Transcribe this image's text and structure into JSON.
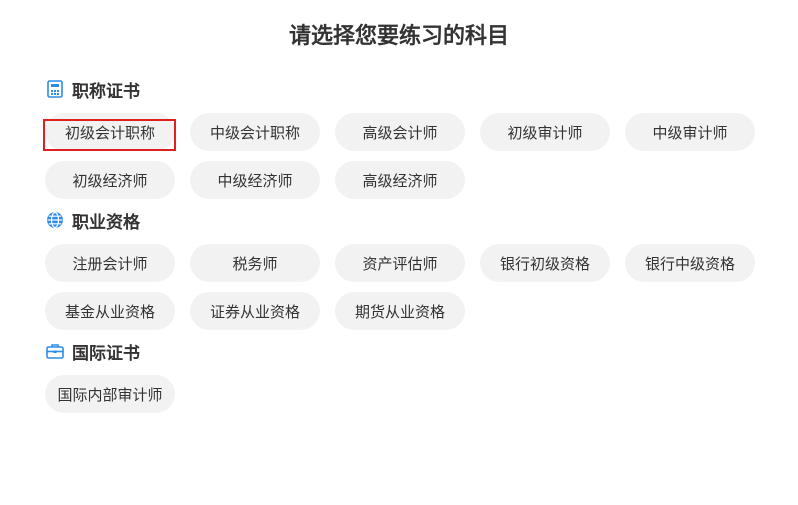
{
  "title": "请选择您要练习的科目",
  "accent_color": "#1e88e5",
  "highlight_color": "#e0201f",
  "sections": [
    {
      "label": "职称证书",
      "icon": "calculator-icon",
      "items": [
        "初级会计职称",
        "中级会计职称",
        "高级会计师",
        "初级审计师",
        "中级审计师",
        "初级经济师",
        "中级经济师",
        "高级经济师"
      ]
    },
    {
      "label": "职业资格",
      "icon": "globe-icon",
      "items": [
        "注册会计师",
        "税务师",
        "资产评估师",
        "银行初级资格",
        "银行中级资格",
        "基金从业资格",
        "证券从业资格",
        "期货从业资格"
      ]
    },
    {
      "label": "国际证书",
      "icon": "briefcase-icon",
      "items": [
        "国际内部审计师"
      ]
    }
  ],
  "selected_item": "初级会计职称"
}
